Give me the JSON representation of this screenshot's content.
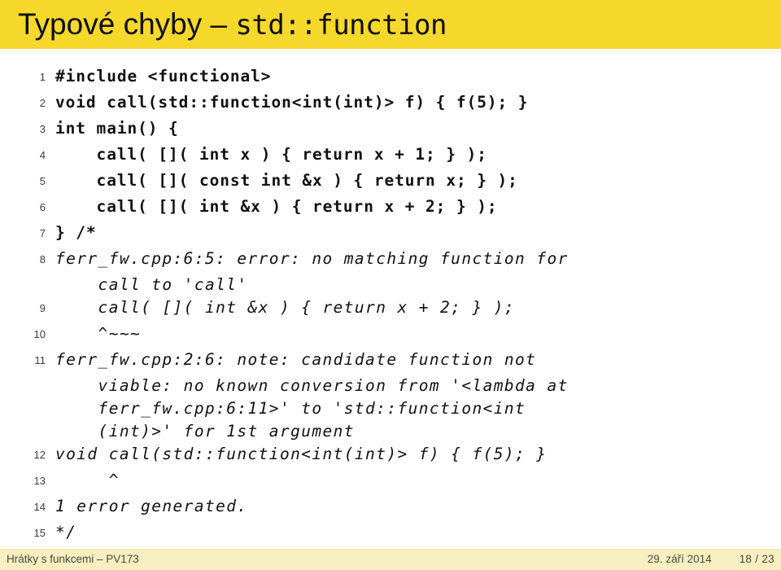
{
  "slide": {
    "title_prefix": "Typové chyby – ",
    "title_mono": "std::function",
    "title_bg": "#f5d829",
    "footer_bg": "#f7efc0"
  },
  "code": {
    "lines": [
      {
        "no": "1",
        "text": "#include <functional>",
        "style": "plain"
      },
      {
        "no": "2",
        "text": "void call(std::function<int(int)> f) { f(5); }",
        "style": "plain"
      },
      {
        "no": "3",
        "text": "int main() {",
        "style": "plain"
      },
      {
        "no": "4",
        "text": "    call( []( int x ) { return x + 1; } );",
        "style": "plain"
      },
      {
        "no": "5",
        "text": "    call( []( const int &x ) { return x; } );",
        "style": "plain"
      },
      {
        "no": "6",
        "text": "    call( []( int &x ) { return x + 2; } );",
        "style": "plain"
      },
      {
        "no": "7",
        "text": "} /*",
        "style": "plain"
      },
      {
        "no": "8",
        "text": "ferr_fw.cpp:6:5: error: no matching function for",
        "style": "comment"
      },
      {
        "no": "",
        "text": "    call to 'call'",
        "style": "cont"
      },
      {
        "no": "9",
        "text": "    call( []( int &x ) { return x + 2; } );",
        "style": "comment"
      },
      {
        "no": "10",
        "text": "    ^~~~",
        "style": "comment"
      },
      {
        "no": "11",
        "text": "ferr_fw.cpp:2:6: note: candidate function not",
        "style": "comment"
      },
      {
        "no": "",
        "text": "    viable: no known conversion from '<lambda at",
        "style": "cont"
      },
      {
        "no": "",
        "text": "    ferr_fw.cpp:6:11>' to 'std::function<int",
        "style": "cont"
      },
      {
        "no": "",
        "text": "    (int)>' for 1st argument",
        "style": "cont"
      },
      {
        "no": "12",
        "text": "void call(std::function<int(int)> f) { f(5); }",
        "style": "comment"
      },
      {
        "no": "13",
        "text": "     ^",
        "style": "comment"
      },
      {
        "no": "14",
        "text": "1 error generated.",
        "style": "comment"
      },
      {
        "no": "15",
        "text": "*/",
        "style": "comment"
      }
    ]
  },
  "footer": {
    "left": "Hrátky s funkcemi – PV173",
    "date": "29. září 2014",
    "page": "18 / 23"
  }
}
